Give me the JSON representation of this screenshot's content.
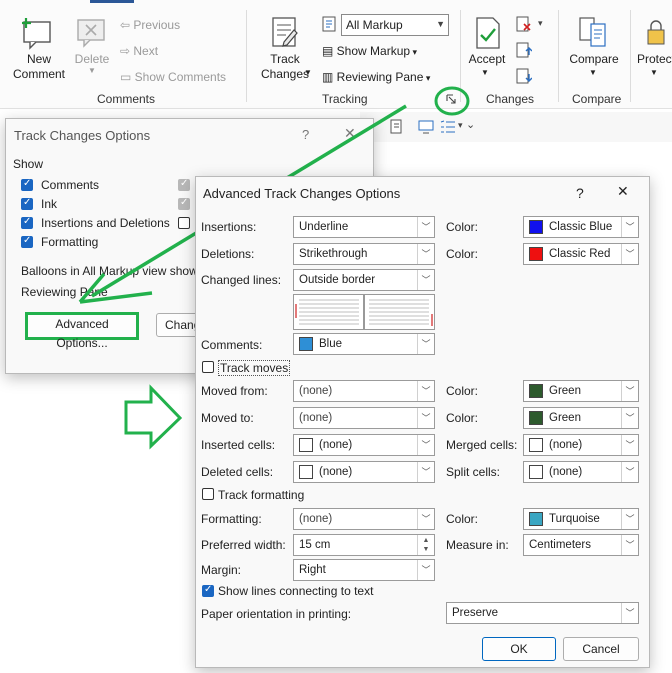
{
  "ribbon": {
    "comments": {
      "new_comment": "New\nComment",
      "delete": "Delete",
      "previous": "Previous",
      "next": "Next",
      "show_comments": "Show Comments",
      "group_label": "Comments"
    },
    "tracking": {
      "track_changes": "Track\nChanges",
      "markup_select": "All Markup",
      "show_markup": "Show Markup",
      "reviewing_pane": "Reviewing Pane",
      "group_label": "Tracking"
    },
    "changes": {
      "accept": "Accept",
      "group_label": "Changes"
    },
    "compare": {
      "compare": "Compare",
      "group_label": "Compare"
    },
    "protect": {
      "label": "Protect"
    }
  },
  "tco_dialog": {
    "title": "Track Changes Options",
    "help": "?",
    "section_show": "Show",
    "options": [
      {
        "label": "Comments",
        "checked": true
      },
      {
        "label": "Ink",
        "checked": true
      },
      {
        "label": "Insertions and Deletions",
        "checked": true
      },
      {
        "label": "Formatting",
        "checked": true
      }
    ],
    "balloons_label": "Balloons in All Markup view show",
    "reviewing_pane_label": "Reviewing Pane",
    "advanced_button": "Advanced Options...",
    "change_user_button": "Chang"
  },
  "atco_dialog": {
    "title": "Advanced Track Changes Options",
    "help": "?",
    "close": "✕",
    "insertions": {
      "label": "Insertions:",
      "value": "Underline",
      "color_label": "Color:",
      "color_value": "Classic Blue",
      "swatch": "#1010ee"
    },
    "deletions": {
      "label": "Deletions:",
      "value": "Strikethrough",
      "color_label": "Color:",
      "color_value": "Classic Red",
      "swatch": "#ee1010"
    },
    "changed_lines": {
      "label": "Changed lines:",
      "value": "Outside border"
    },
    "comments": {
      "label": "Comments:",
      "value": "Blue",
      "swatch": "#2e8fd6"
    },
    "track_moves": {
      "label": "Track moves",
      "checked": false
    },
    "moved_from": {
      "label": "Moved from:",
      "value": "(none)",
      "color_label": "Color:",
      "color_value": "Green",
      "swatch": "#2d5a2d"
    },
    "moved_to": {
      "label": "Moved to:",
      "value": "(none)",
      "color_label": "Color:",
      "color_value": "Green",
      "swatch": "#2d5a2d"
    },
    "inserted_cells": {
      "label": "Inserted cells:",
      "value": "(none)",
      "merged_label": "Merged cells:",
      "merged_value": "(none)"
    },
    "deleted_cells": {
      "label": "Deleted cells:",
      "value": "(none)",
      "split_label": "Split cells:",
      "split_value": "(none)"
    },
    "track_formatting": {
      "label": "Track formatting",
      "checked": false
    },
    "formatting": {
      "label": "Formatting:",
      "value": "(none)",
      "color_label": "Color:",
      "color_value": "Turquoise",
      "swatch": "#3aa6c2"
    },
    "preferred_width": {
      "label": "Preferred width:",
      "value": "15 cm",
      "measure_label": "Measure in:",
      "measure_value": "Centimeters"
    },
    "margin": {
      "label": "Margin:",
      "value": "Right"
    },
    "show_lines": {
      "label": "Show lines connecting to text",
      "checked": true
    },
    "paper_orientation": {
      "label": "Paper orientation in printing:",
      "value": "Preserve"
    },
    "ok": "OK",
    "cancel": "Cancel"
  },
  "annotation_color": "#22b14c"
}
